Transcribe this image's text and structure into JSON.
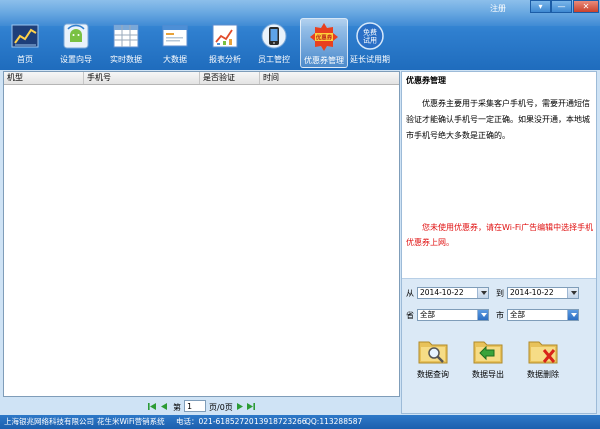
{
  "window": {
    "register_label": "注册",
    "controls": {
      "dropdown": "▾",
      "minimize": "—",
      "close": "✕"
    }
  },
  "nav": {
    "items": [
      {
        "label": "首页",
        "icon": "home-chart-icon"
      },
      {
        "label": "设置向导",
        "icon": "android-wifi-icon"
      },
      {
        "label": "实时数据",
        "icon": "grid-table-icon"
      },
      {
        "label": "大数据",
        "icon": "browser-window-icon"
      },
      {
        "label": "报表分析",
        "icon": "report-chart-icon"
      },
      {
        "label": "员工管控",
        "icon": "phone-control-icon"
      },
      {
        "label": "优惠券管理",
        "icon": "coupon-icon",
        "active": true
      },
      {
        "label": "延长试用期",
        "icon": "free-trial-icon",
        "badge": "免费\n试用"
      }
    ],
    "badges": {
      "coupon": "优惠券",
      "trial_line1": "免费",
      "trial_line2": "试用"
    }
  },
  "table": {
    "columns": [
      "机型",
      "手机号",
      "是否验证",
      "时间"
    ],
    "rows": []
  },
  "pager": {
    "prefix": "第",
    "page_value": "1",
    "suffix": "页/0页"
  },
  "panel": {
    "title": "优惠券管理",
    "description": "优惠券主要用于采集客户手机号，需要开通短信验证才能确认手机号一定正确。如果没开通，本地城市手机号绝大多数是正确的。",
    "notice": "您未使用优惠券，请在Wi-Fi广告编辑中选择手机优惠券上网。",
    "filters": {
      "from_label": "从",
      "from_value": "2014-10-22",
      "to_label": "到",
      "to_value": "2014-10-22",
      "province_label": "省",
      "province_value": "全部",
      "city_label": "市",
      "city_value": "全部"
    },
    "actions": [
      {
        "label": "数据查询",
        "icon": "folder-search-icon"
      },
      {
        "label": "数据导出",
        "icon": "folder-export-icon"
      },
      {
        "label": "数据删除",
        "icon": "folder-delete-icon"
      }
    ]
  },
  "status": {
    "company": "上海银兆网络科技有限公司",
    "product": "花生米WiFi营销系统",
    "phone": "电话：021-61852720",
    "mobile": "13918723266",
    "qq": "QQ:113288587"
  },
  "colors": {
    "banner": "#2f7fcf",
    "status_bar": "#1c5fae",
    "notice_red": "#e01010",
    "panel_bg": "#dbe9f6"
  }
}
